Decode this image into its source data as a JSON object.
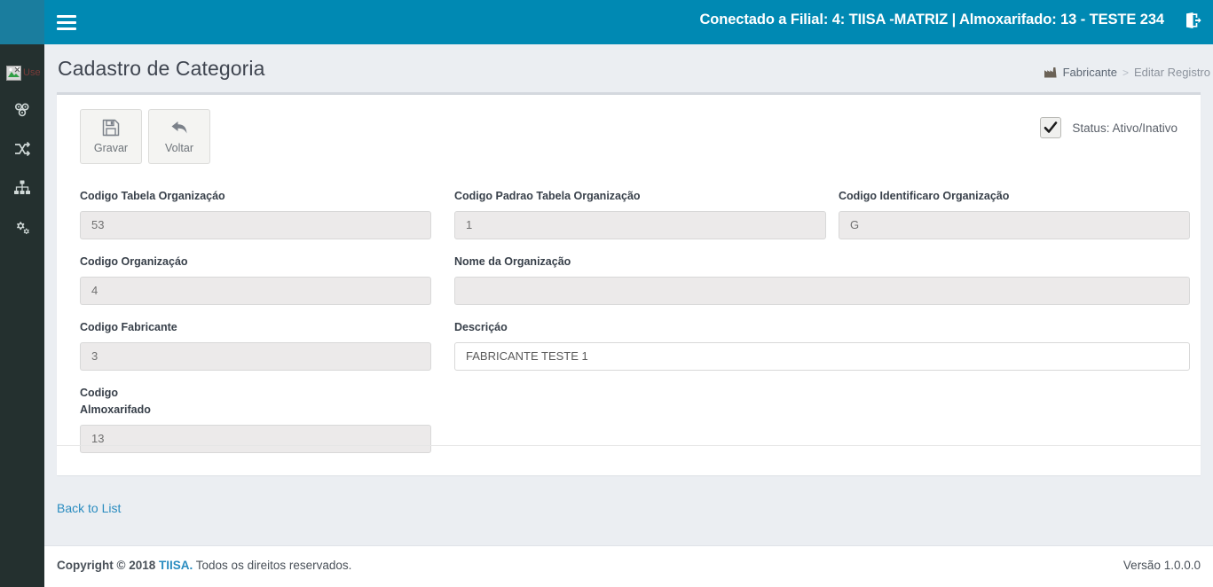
{
  "topbar": {
    "menu_icon": "hamburger-icon",
    "connection_text": "Conectado a Filial: 4: TIISA -MATRIZ | Almoxarifado: 13 - TESTE 234",
    "logout_icon": "sign-out-icon"
  },
  "sidebar": {
    "brand_alt_text": "Use",
    "brand_icon": "broken-image-icon",
    "items": [
      {
        "icon": "cubes-icon",
        "label": ""
      },
      {
        "icon": "shuffle-icon",
        "label": ""
      },
      {
        "icon": "sitemap-icon",
        "label": ""
      },
      {
        "icon": "cogs-icon",
        "label": ""
      }
    ]
  },
  "page": {
    "title": "Cadastro de Categoria",
    "breadcrumb": {
      "icon": "factory-icon",
      "parent": "Fabricante",
      "separator": ">",
      "current": "Editar Registro"
    }
  },
  "toolbar": {
    "save_label": "Gravar",
    "save_icon": "floppy-save-icon",
    "back_label": "Voltar",
    "back_icon": "arrow-back-icon"
  },
  "status": {
    "checked": true,
    "label": "Status: Ativo/Inativo"
  },
  "form": {
    "fields": [
      {
        "label": "Codigo Tabela Organizaçáo",
        "value": "53",
        "editable": false
      },
      {
        "label": "Codigo Padrao Tabela Organização",
        "value": "1",
        "editable": false
      },
      {
        "label": "Codigo Identificaro Organização",
        "value": "G",
        "editable": false
      },
      {
        "label": "Codigo Organizaçáo",
        "value": "4",
        "editable": false
      },
      {
        "label": "Nome da Organização",
        "value": "",
        "editable": false
      },
      {
        "label": "Codigo Fabricante",
        "value": "3",
        "editable": false
      },
      {
        "label": "Descriçáo",
        "value": "FABRICANTE TESTE 1",
        "editable": true
      },
      {
        "label": "Codigo Almoxarifado",
        "value": "13",
        "editable": false
      }
    ]
  },
  "back_to_list": "Back to List",
  "footer": {
    "copyright_prefix": "Copyright © 2018",
    "brand": "TIISA.",
    "copyright_suffix": "Todos os direitos reservados.",
    "version": "Versão 1.0.0.0"
  },
  "colors": {
    "topbar": "#0089b3",
    "sidebar": "#24302f",
    "sidebar_head": "#1a7d9e",
    "page_bg": "#ebeef2",
    "link": "#2a8cc0"
  }
}
